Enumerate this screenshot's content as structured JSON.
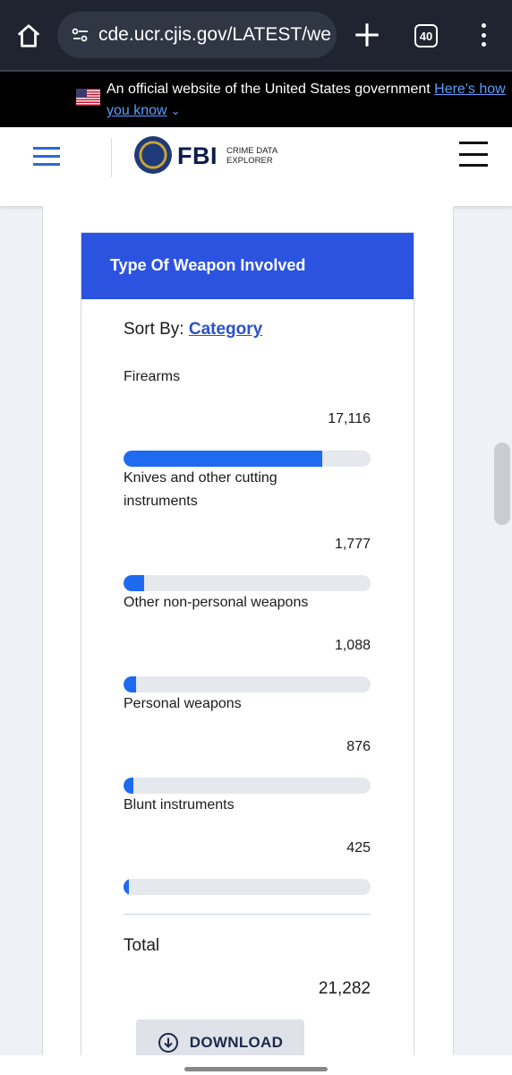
{
  "browser": {
    "url": "cde.ucr.cjis.gov/LATEST/we",
    "tab_count": "40"
  },
  "gov_banner": {
    "text": "An official website of the United States government",
    "link_text": "Here's how you know"
  },
  "site_header": {
    "brand": "FBI",
    "subtitle_line1": "CRIME DATA",
    "subtitle_line2": "EXPLORER"
  },
  "panel": {
    "title": "Type Of Weapon Involved",
    "sort_label": "Sort By:",
    "sort_value": "Category",
    "items": [
      {
        "label": "Firearms",
        "value": "17,116",
        "fraction": 0.804
      },
      {
        "label": "Knives and other cutting instruments",
        "value": "1,777",
        "fraction": 0.083
      },
      {
        "label": "Other non-personal weapons",
        "value": "1,088",
        "fraction": 0.051
      },
      {
        "label": "Personal weapons",
        "value": "876",
        "fraction": 0.041
      },
      {
        "label": "Blunt instruments",
        "value": "425",
        "fraction": 0.02
      }
    ],
    "total_label": "Total",
    "total_value": "21,282",
    "download_label": "DOWNLOAD"
  },
  "colors": {
    "accent": "#2c53e0",
    "bar_fill": "#1f6bf0",
    "bar_track": "#e5e8ec"
  },
  "icons": {
    "home": "home-icon",
    "site_settings": "tune-icon",
    "new_tab": "plus-icon",
    "tabs": "tab-switcher-icon",
    "more": "more-vert-icon",
    "download": "download-circle-icon"
  }
}
